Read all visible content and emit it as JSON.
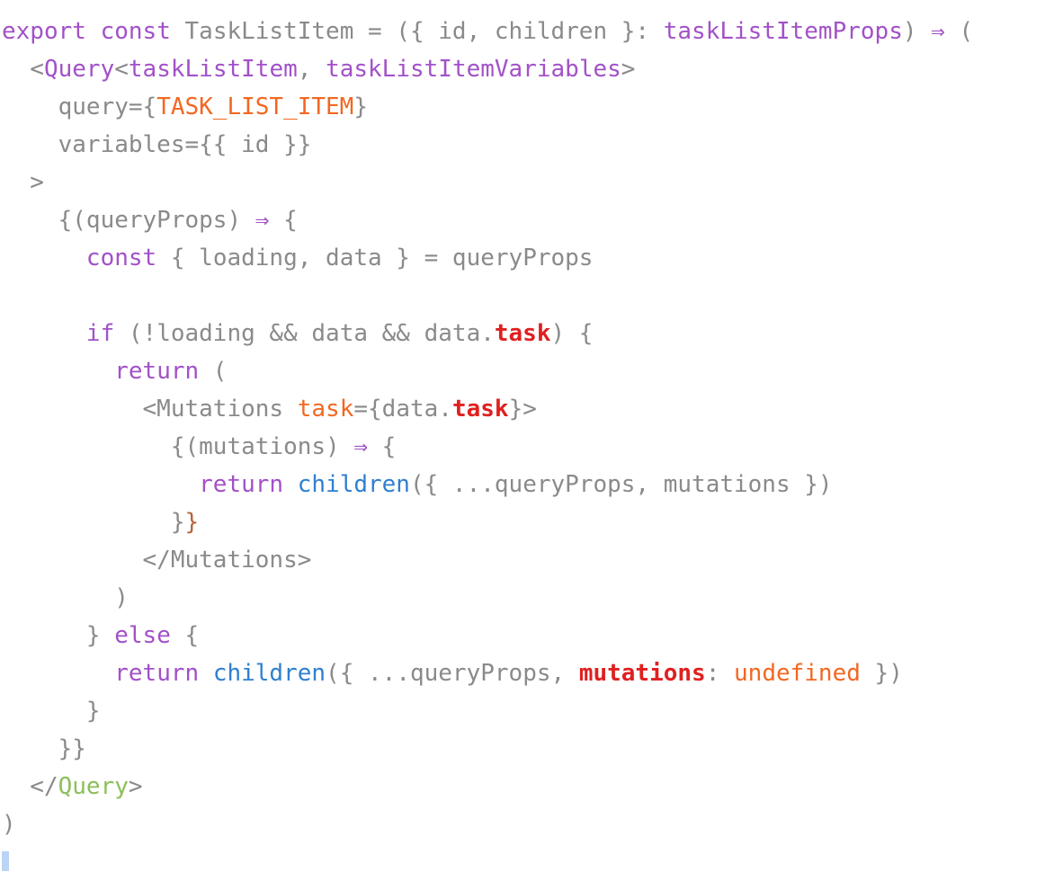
{
  "editor": {
    "language": "tsx",
    "background": "#ffffff",
    "font_size_px": 26,
    "line_height_px": 42,
    "colors": {
      "plain": "#8a8a8a",
      "keyword": "#a251c8",
      "type": "#a251c8",
      "tag_name": "#a251c8",
      "closing_tag_name": "#8cbf5a",
      "constant": "#f26722",
      "attribute": "#f26722",
      "property": "#e02020",
      "function": "#2f7fd1",
      "brace_highlight": "#b5633b",
      "caret": "#bad4f5"
    },
    "caret_line_index": 22
  },
  "code": {
    "plain_text": "export const TaskListItem = ({ id, children }: taskListItemProps) => (\n  <Query<taskListItem, taskListItemVariables>\n    query={TASK_LIST_ITEM}\n    variables={{ id }}\n  >\n    {(queryProps) => {\n      const { loading, data } = queryProps\n\n      if (!loading && data && data.task) {\n        return (\n          <Mutations task={data.task}>\n            {(mutations) => {\n              return children({ ...queryProps, mutations })\n            }}\n          </Mutations>\n        )\n      } else {\n        return children({ ...queryProps, mutations: undefined })\n      }\n    }}\n  </Query>\n)\n",
    "lines": [
      {
        "tokens": [
          {
            "text": "export",
            "type": "keyword"
          },
          {
            "text": " ",
            "type": "plain"
          },
          {
            "text": "const",
            "type": "keyword"
          },
          {
            "text": " TaskListItem = ({ id, children }: ",
            "type": "plain"
          },
          {
            "text": "taskListItemProps",
            "type": "type"
          },
          {
            "text": ") ",
            "type": "plain"
          },
          {
            "text": "⇒",
            "type": "arrow"
          },
          {
            "text": " (",
            "type": "plain"
          }
        ]
      },
      {
        "tokens": [
          {
            "text": "  <",
            "type": "plain"
          },
          {
            "text": "Query",
            "type": "tagname"
          },
          {
            "text": "<",
            "type": "plain"
          },
          {
            "text": "taskListItem",
            "type": "type"
          },
          {
            "text": ", ",
            "type": "plain"
          },
          {
            "text": "taskListItemVariables",
            "type": "type"
          },
          {
            "text": ">",
            "type": "plain"
          }
        ]
      },
      {
        "tokens": [
          {
            "text": "    query={",
            "type": "plain"
          },
          {
            "text": "TASK_LIST_ITEM",
            "type": "const"
          },
          {
            "text": "}",
            "type": "plain"
          }
        ]
      },
      {
        "tokens": [
          {
            "text": "    variables={{ id }}",
            "type": "plain"
          }
        ]
      },
      {
        "tokens": [
          {
            "text": "  >",
            "type": "plain"
          }
        ]
      },
      {
        "tokens": [
          {
            "text": "    {(queryProps) ",
            "type": "plain"
          },
          {
            "text": "⇒",
            "type": "arrow"
          },
          {
            "text": " {",
            "type": "plain"
          }
        ]
      },
      {
        "tokens": [
          {
            "text": "      ",
            "type": "plain"
          },
          {
            "text": "const",
            "type": "keyword"
          },
          {
            "text": " { loading, data } = queryProps",
            "type": "plain"
          }
        ]
      },
      {
        "tokens": []
      },
      {
        "tokens": [
          {
            "text": "      ",
            "type": "plain"
          },
          {
            "text": "if",
            "type": "keyword"
          },
          {
            "text": " (!loading && data && data.",
            "type": "plain"
          },
          {
            "text": "task",
            "type": "prop"
          },
          {
            "text": ") {",
            "type": "plain"
          }
        ]
      },
      {
        "tokens": [
          {
            "text": "        ",
            "type": "plain"
          },
          {
            "text": "return",
            "type": "keyword"
          },
          {
            "text": " (",
            "type": "plain"
          }
        ]
      },
      {
        "tokens": [
          {
            "text": "          <Mutations ",
            "type": "plain"
          },
          {
            "text": "task",
            "type": "attr"
          },
          {
            "text": "={data.",
            "type": "plain"
          },
          {
            "text": "task",
            "type": "prop"
          },
          {
            "text": "}>",
            "type": "plain"
          }
        ]
      },
      {
        "tokens": [
          {
            "text": "            {(mutations) ",
            "type": "plain"
          },
          {
            "text": "⇒",
            "type": "arrow"
          },
          {
            "text": " {",
            "type": "plain"
          }
        ]
      },
      {
        "tokens": [
          {
            "text": "              ",
            "type": "plain"
          },
          {
            "text": "return",
            "type": "keyword"
          },
          {
            "text": " ",
            "type": "plain"
          },
          {
            "text": "children",
            "type": "func"
          },
          {
            "text": "({ ...queryProps, mutations })",
            "type": "plain"
          }
        ]
      },
      {
        "tokens": [
          {
            "text": "            }",
            "type": "plain"
          },
          {
            "text": "}",
            "type": "brace"
          }
        ]
      },
      {
        "tokens": [
          {
            "text": "          </Mutations>",
            "type": "plain"
          }
        ]
      },
      {
        "tokens": [
          {
            "text": "        )",
            "type": "plain"
          }
        ]
      },
      {
        "tokens": [
          {
            "text": "      } ",
            "type": "plain"
          },
          {
            "text": "else",
            "type": "keyword"
          },
          {
            "text": " {",
            "type": "plain"
          }
        ]
      },
      {
        "tokens": [
          {
            "text": "        ",
            "type": "plain"
          },
          {
            "text": "return",
            "type": "keyword"
          },
          {
            "text": " ",
            "type": "plain"
          },
          {
            "text": "children",
            "type": "func"
          },
          {
            "text": "({ ...queryProps, ",
            "type": "plain"
          },
          {
            "text": "mutations",
            "type": "prop"
          },
          {
            "text": ": ",
            "type": "plain"
          },
          {
            "text": "undefined",
            "type": "const"
          },
          {
            "text": " })",
            "type": "plain"
          }
        ]
      },
      {
        "tokens": [
          {
            "text": "      }",
            "type": "plain"
          }
        ]
      },
      {
        "tokens": [
          {
            "text": "    }}",
            "type": "plain"
          }
        ]
      },
      {
        "tokens": [
          {
            "text": "  </",
            "type": "plain"
          },
          {
            "text": "Query",
            "type": "closetag"
          },
          {
            "text": ">",
            "type": "plain"
          }
        ]
      },
      {
        "tokens": [
          {
            "text": ")",
            "type": "plain"
          }
        ]
      },
      {
        "tokens": []
      }
    ]
  }
}
